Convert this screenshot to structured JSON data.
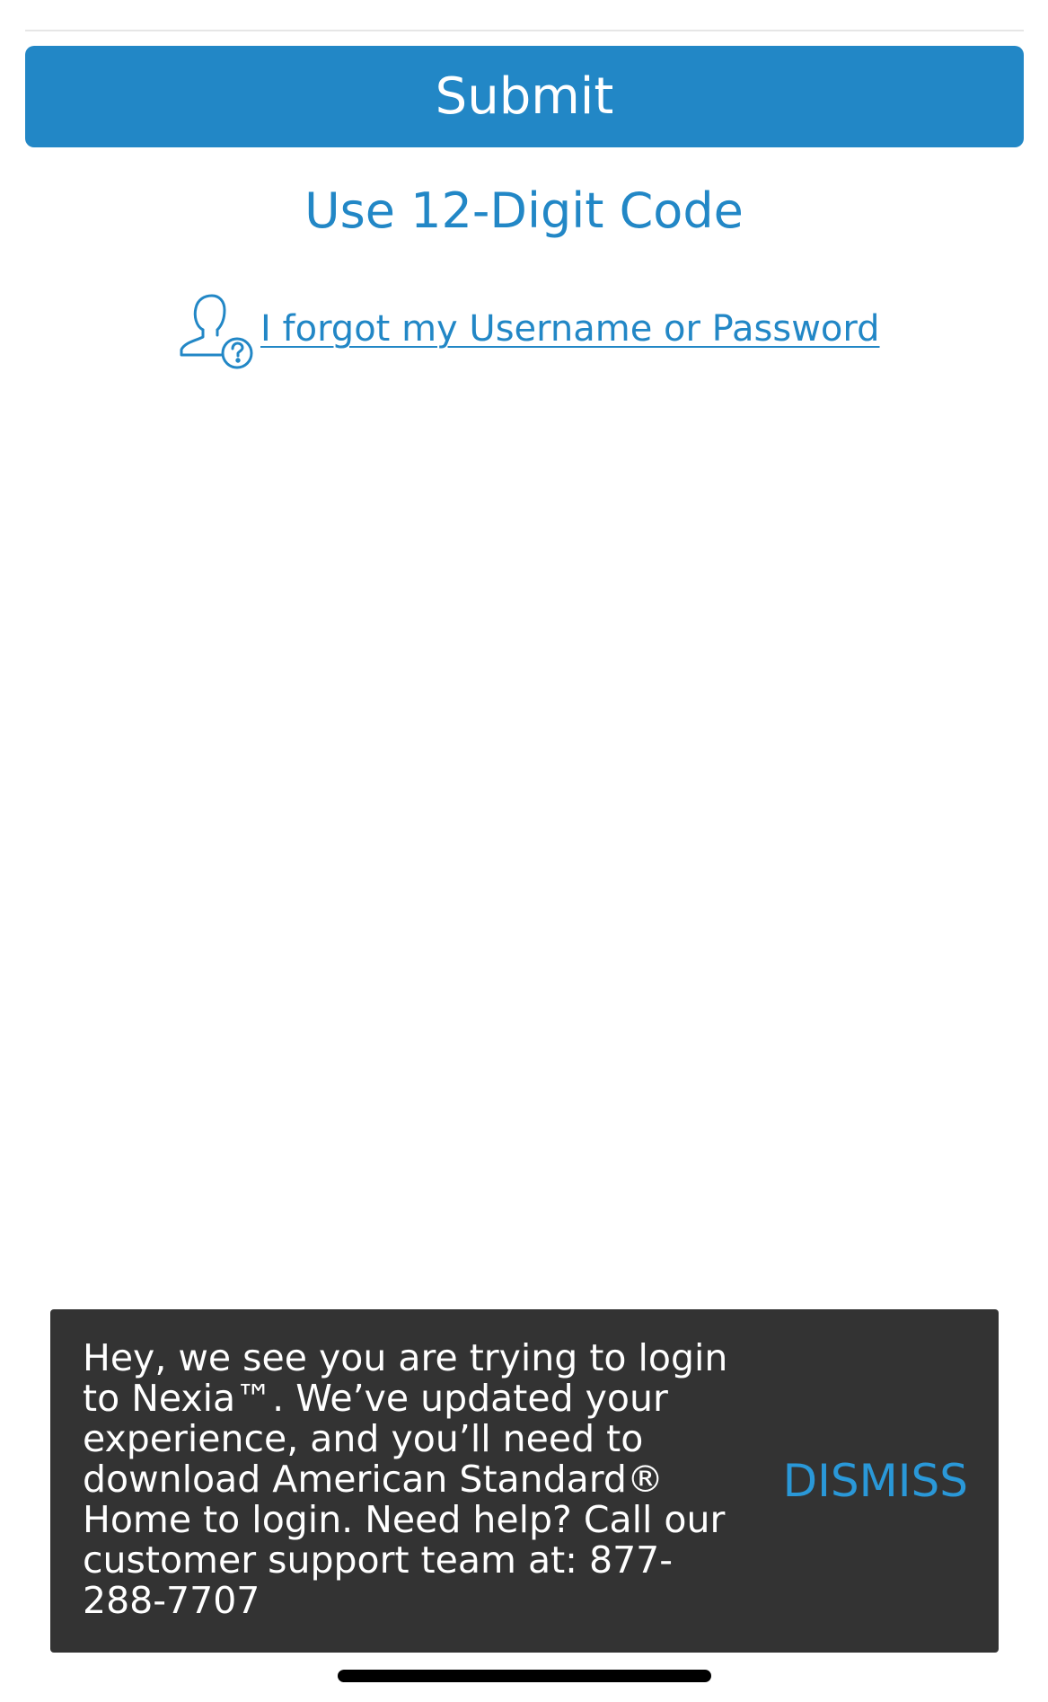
{
  "form": {
    "submit_label": "Submit",
    "code_link_label": "Use 12-Digit Code",
    "forgot_link_label": "I forgot my Username or Password",
    "forgot_icon": "user-question-icon"
  },
  "toast": {
    "message": "Hey, we see you are trying to login to Nexia™. We’ve updated your experience, and you’ll need to download American Standard® Home to login. Need help? Call our customer support team at: 877-288-7707",
    "dismiss_label": "DISMISS"
  },
  "colors": {
    "accent": "#2287c6",
    "toast_background": "#333333",
    "dismiss": "#2a98d8"
  }
}
